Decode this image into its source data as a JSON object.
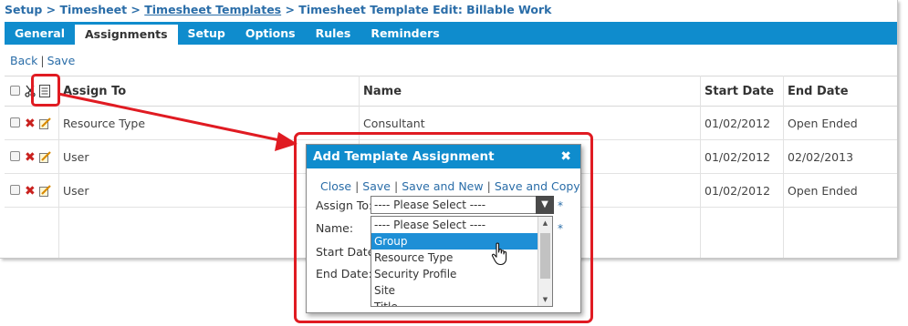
{
  "breadcrumb": {
    "part1": "Setup > Timesheet > ",
    "link": "Timesheet Templates",
    "part2": " > Timesheet Template Edit: Billable Work"
  },
  "tabs": [
    {
      "label": "General"
    },
    {
      "label": "Assignments",
      "active": true
    },
    {
      "label": "Setup"
    },
    {
      "label": "Options"
    },
    {
      "label": "Rules"
    },
    {
      "label": "Reminders"
    }
  ],
  "actions": {
    "back": "Back",
    "sep": "|",
    "save": "Save"
  },
  "grid": {
    "headers": {
      "assign_to": "Assign To",
      "name": "Name",
      "start_date": "Start Date",
      "end_date": "End Date"
    },
    "rows": [
      {
        "assign_to": "Resource Type",
        "name": "Consultant",
        "start_date": "01/02/2012",
        "end_date": "Open Ended"
      },
      {
        "assign_to": "User",
        "name": "",
        "start_date": "01/02/2012",
        "end_date": "02/02/2013"
      },
      {
        "assign_to": "User",
        "name": "",
        "start_date": "01/02/2012",
        "end_date": "Open Ended"
      }
    ]
  },
  "dialog": {
    "title": "Add Template Assignment",
    "close_glyph": "✖",
    "actions": {
      "close": "Close",
      "save": "Save",
      "save_new": "Save and New",
      "save_copy": "Save and Copy",
      "sep": "|"
    },
    "labels": {
      "assign_to": "Assign To:",
      "name": "Name:",
      "start_date": "Start Date:",
      "end_date": "End Date:"
    },
    "required_mark": "*",
    "select_value": "---- Please Select ----",
    "options": [
      "---- Please Select ----",
      "Group",
      "Resource Type",
      "Security Profile",
      "Site",
      "Title"
    ],
    "selected_option": "Group"
  },
  "icons": {
    "delete": "delete-x-icon",
    "edit": "edit-pencil-icon",
    "list": "list-icon",
    "cursor": "hand-pointer-icon"
  },
  "colors": {
    "tab_bar": "#0f8ccd",
    "link": "#2a6da8",
    "highlight": "#e01b22",
    "selected_option": "#1e8fd6"
  }
}
